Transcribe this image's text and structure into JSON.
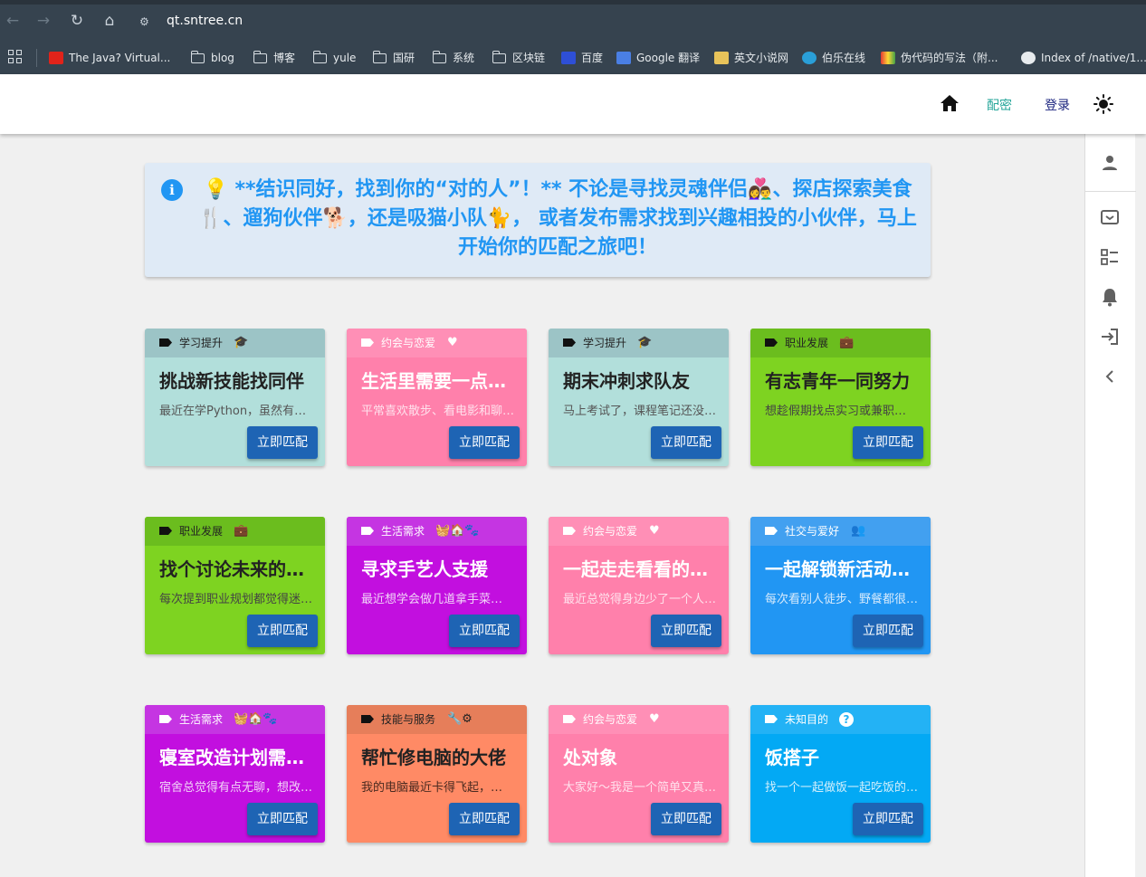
{
  "browser": {
    "url": "qt.sntree.cn",
    "bookmarks": [
      {
        "label": "The Java? Virtual...",
        "icon": "oracle-icon"
      },
      {
        "label": "blog",
        "icon": "folder-icon"
      },
      {
        "label": "博客",
        "icon": "folder-icon"
      },
      {
        "label": "yule",
        "icon": "folder-icon"
      },
      {
        "label": "国研",
        "icon": "folder-icon"
      },
      {
        "label": "系统",
        "icon": "folder-icon"
      },
      {
        "label": "区块链",
        "icon": "folder-icon"
      },
      {
        "label": "百度",
        "icon": "baidu-icon"
      },
      {
        "label": "Google 翻译",
        "icon": "google-translate-icon"
      },
      {
        "label": "英文小说网",
        "icon": "site-icon"
      },
      {
        "label": "伯乐在线",
        "icon": "site-icon"
      },
      {
        "label": "伪代码的写法（附...",
        "icon": "site-icon"
      },
      {
        "label": "Index of /native/1...",
        "icon": "globe-icon"
      }
    ]
  },
  "header": {
    "nav_pair": "配密",
    "nav_login": "登录"
  },
  "alert": {
    "text": "💡 **结识同好，找到你的“对的人”！** 不论是寻找灵魂伴侣👩‍❤️‍👨、探店探索美食🍴、遛狗伙伴🐕，还是吸猫小队🐈， 或者发布需求找到兴趣相投的小伙伴，马上开始你的匹配之旅吧！"
  },
  "cards": [
    {
      "category": "学习提升",
      "category_icon": "graduation-cap-icon",
      "title": "挑战新技能找同伴",
      "desc": "最近在学Python，虽然有点难…",
      "button": "立即匹配",
      "head_color": "#9cc4c6",
      "body_color": "#b2dfdb",
      "text_color": "#222222",
      "desc_color": "#555555"
    },
    {
      "category": "约会与恋爱",
      "category_icon": "heart-icon",
      "title": "生活里需要一点浪漫",
      "desc": "平常喜欢散步、看电影和聊天…",
      "button": "立即匹配",
      "head_color": "#ff8fb6",
      "body_color": "#ff80ab",
      "text_color": "#ffffff",
      "desc_color": "#ffe0ec"
    },
    {
      "category": "学习提升",
      "category_icon": "graduation-cap-icon",
      "title": "期末冲刺求队友",
      "desc": "马上考试了，课程笔记还没整理…",
      "button": "立即匹配",
      "head_color": "#9cc4c6",
      "body_color": "#b2dfdb",
      "text_color": "#222222",
      "desc_color": "#555555"
    },
    {
      "category": "职业发展",
      "category_icon": "briefcase-icon",
      "title": "有志青年一同努力",
      "desc": "想趁假期找点实习或兼职…",
      "button": "立即匹配",
      "head_color": "#6bbd1e",
      "body_color": "#7ed321",
      "text_color": "#222222",
      "desc_color": "#444444"
    },
    {
      "category": "职业发展",
      "category_icon": "briefcase-icon",
      "title": "找个讨论未来的伙伴",
      "desc": "每次提到职业规划都觉得迷茫…",
      "button": "立即匹配",
      "head_color": "#6bbd1e",
      "body_color": "#7ed321",
      "text_color": "#222222",
      "desc_color": "#444444"
    },
    {
      "category": "生活需求",
      "category_icon": "home-pets-icon",
      "title": "寻求手艺人支援",
      "desc": "最近想学会做几道拿手菜…",
      "button": "立即匹配",
      "head_color": "#c535e2",
      "body_color": "#c20fdf",
      "text_color": "#ffffff",
      "desc_color": "#f1d4f8"
    },
    {
      "category": "约会与恋爱",
      "category_icon": "heart-icon",
      "title": "一起走走看看的伙伴",
      "desc": "最近总觉得身边少了一个人…",
      "button": "立即匹配",
      "head_color": "#ff8fb6",
      "body_color": "#ff80ab",
      "text_color": "#ffffff",
      "desc_color": "#ffe0ec"
    },
    {
      "category": "社交与爱好",
      "category_icon": "group-icon",
      "title": "一起解锁新活动的伙伴",
      "desc": "每次看别人徒步、野餐都很羡慕…",
      "button": "立即匹配",
      "head_color": "#42a0f0",
      "body_color": "#2196f3",
      "text_color": "#ffffff",
      "desc_color": "#d6eafc"
    },
    {
      "category": "生活需求",
      "category_icon": "home-pets-icon",
      "title": "寝室改造计划需要你",
      "desc": "宿舍总觉得有点无聊，想改造…",
      "button": "立即匹配",
      "head_color": "#c535e2",
      "body_color": "#c20fdf",
      "text_color": "#ffffff",
      "desc_color": "#f1d4f8"
    },
    {
      "category": "技能与服务",
      "category_icon": "tools-icon",
      "title": "帮忙修电脑的大佬",
      "desc": "我的电脑最近卡得飞起，…",
      "button": "立即匹配",
      "head_color": "#e67e5a",
      "body_color": "#ff8a65",
      "text_color": "#222222",
      "desc_color": "#4a2a20"
    },
    {
      "category": "约会与恋爱",
      "category_icon": "heart-icon",
      "title": "处对象",
      "desc": "大家好～我是一个简单又真诚的人…",
      "button": "立即匹配",
      "head_color": "#ff8fb6",
      "body_color": "#ff80ab",
      "text_color": "#ffffff",
      "desc_color": "#ffe0ec"
    },
    {
      "category": "未知目的",
      "category_icon": "question-icon",
      "title": "饭搭子",
      "desc": "找一个一起做饭一起吃饭的人…",
      "button": "立即匹配",
      "head_color": "#23b2f5",
      "body_color": "#03a9f4",
      "text_color": "#ffffff",
      "desc_color": "#d2effc"
    }
  ]
}
